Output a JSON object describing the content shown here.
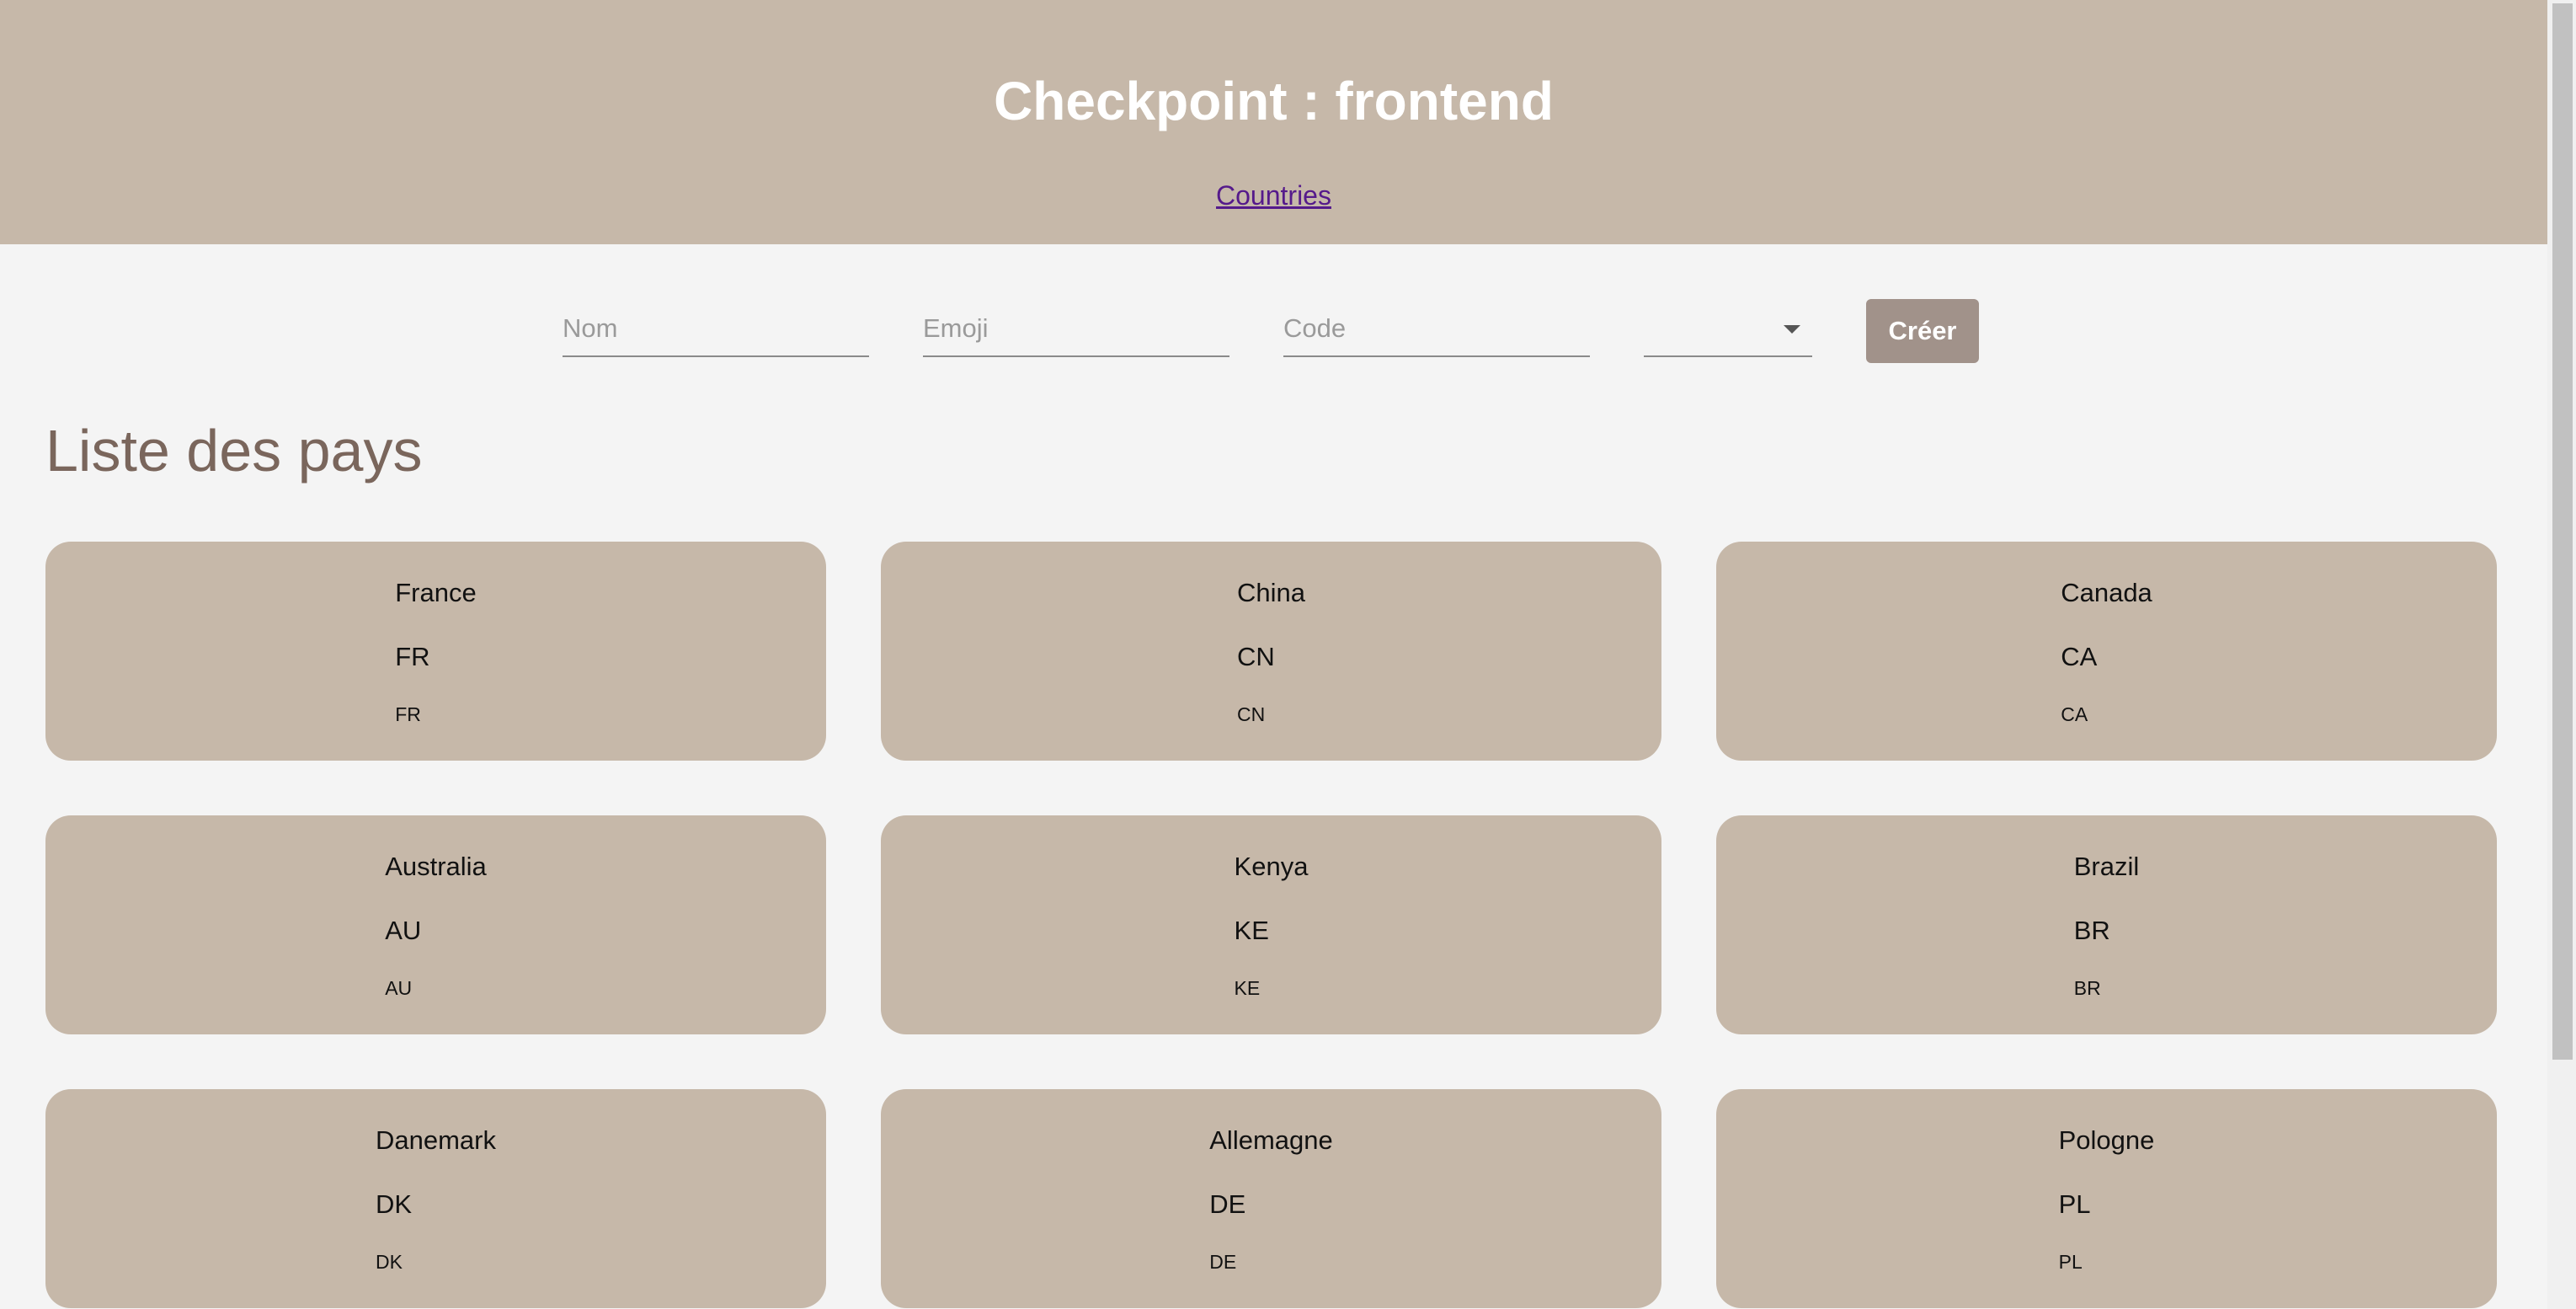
{
  "header": {
    "title": "Checkpoint : frontend",
    "nav_link": "Countries"
  },
  "form": {
    "name_placeholder": "Nom",
    "emoji_placeholder": "Emoji",
    "code_placeholder": "Code",
    "continent_selected": "",
    "submit_label": "Créer"
  },
  "section": {
    "title": "Liste des pays"
  },
  "countries": [
    {
      "name": "France",
      "emoji": "FR",
      "code": "FR"
    },
    {
      "name": "China",
      "emoji": "CN",
      "code": "CN"
    },
    {
      "name": "Canada",
      "emoji": "CA",
      "code": "CA"
    },
    {
      "name": "Australia",
      "emoji": "AU",
      "code": "AU"
    },
    {
      "name": "Kenya",
      "emoji": "KE",
      "code": "KE"
    },
    {
      "name": "Brazil",
      "emoji": "BR",
      "code": "BR"
    },
    {
      "name": "Danemark",
      "emoji": "DK",
      "code": "DK"
    },
    {
      "name": "Allemagne",
      "emoji": "DE",
      "code": "DE"
    },
    {
      "name": "Pologne",
      "emoji": "PL",
      "code": "PL"
    }
  ],
  "colors": {
    "header_bg": "#c6b8a9",
    "card_bg": "#c6b8a9",
    "button_bg": "#a1928a",
    "section_title": "#7a665c",
    "link": "#551a8b"
  },
  "icons": {
    "select_arrow": "chevron-down-icon"
  }
}
